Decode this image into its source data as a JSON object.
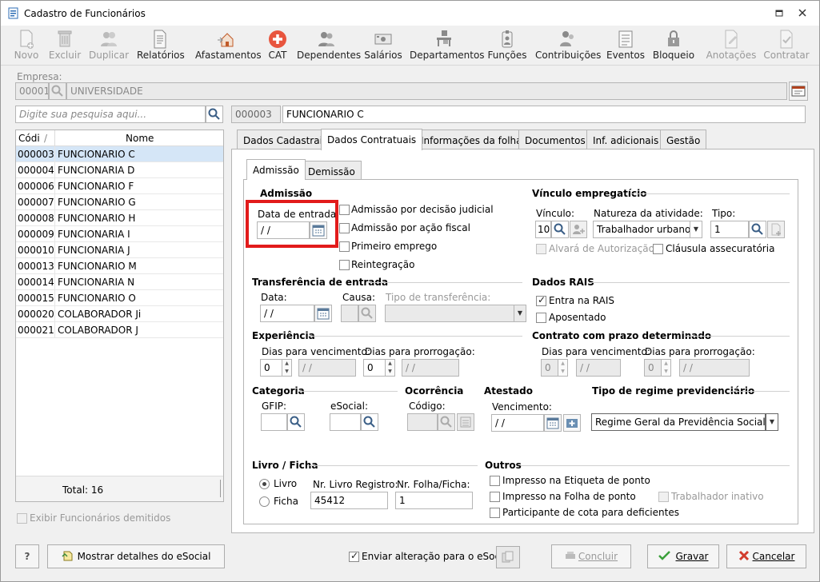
{
  "window": {
    "title": "Cadastro de Funcionários"
  },
  "toolbar": {
    "novo": "Novo",
    "excluir": "Excluir",
    "duplicar": "Duplicar",
    "relatorios": "Relatórios",
    "afastamentos": "Afastamentos",
    "cat": "CAT",
    "dependentes": "Dependentes",
    "salarios": "Salários",
    "departamentos": "Departamentos",
    "funcoes": "Funções",
    "contribuicoes": "Contribuições",
    "eventos": "Eventos",
    "bloqueio": "Bloqueio",
    "anotacoes": "Anotações",
    "contratar": "Contratar"
  },
  "empresa": {
    "label": "Empresa:",
    "code": "00001",
    "name": "UNIVERSIDADE"
  },
  "search": {
    "placeholder": "Digite sua pesquisa aqui..."
  },
  "current": {
    "code": "000003",
    "name": "FUNCIONARIO C"
  },
  "list": {
    "col_code": "Códi",
    "col_name": "Nome",
    "sort_mark": "/",
    "rows": [
      {
        "code": "000003",
        "name": "FUNCIONARIO C"
      },
      {
        "code": "000004",
        "name": "FUNCIONARIA D"
      },
      {
        "code": "000006",
        "name": "FUNCIONARIO F"
      },
      {
        "code": "000007",
        "name": "FUNCIONARIO G"
      },
      {
        "code": "000008",
        "name": "FUNCIONARIO H"
      },
      {
        "code": "000009",
        "name": "FUNCIONARIA I"
      },
      {
        "code": "000010",
        "name": "FUNCIONARIA J"
      },
      {
        "code": "000013",
        "name": "FUNCIONARIO M"
      },
      {
        "code": "000014",
        "name": "FUNCIONARIA N"
      },
      {
        "code": "000015",
        "name": "FUNCIONARIO O"
      },
      {
        "code": "000020",
        "name": "COLABORADOR Ji"
      },
      {
        "code": "000021",
        "name": "COLABORADOR J"
      }
    ],
    "total": "Total: 16"
  },
  "exibir_demitidos": "Exibir Funcionários demitidos",
  "tabs": [
    "Dados Cadastrais",
    "Dados Contratuais",
    "Informações da folha",
    "Documentos",
    "Inf. adicionais",
    "Gestão"
  ],
  "subtabs": [
    "Admissão",
    "Demissão"
  ],
  "admissao": {
    "title": "Admissão",
    "data_entrada": "Data de entrada:",
    "data_value": " / /",
    "decisao_judicial": "Admissão por decisão judicial",
    "acao_fiscal": "Admissão por ação fiscal",
    "primeiro_emprego": "Primeiro emprego",
    "reintegracao": "Reintegração"
  },
  "vinculo": {
    "title": "Vínculo empregatício",
    "vinculo_label": "Vínculo:",
    "vinculo_value": "10",
    "natureza_label": "Natureza da atividade:",
    "natureza_value": "Trabalhador urbano",
    "tipo_label": "Tipo:",
    "tipo_value": "1",
    "alvara": "Alvará de Autorização",
    "clausula": "Cláusula assecuratória"
  },
  "transferencia": {
    "title": "Transferência de entrada",
    "data_label": "Data:",
    "data_value": " / /",
    "causa_label": "Causa:",
    "tipo_label": "Tipo de transferência:"
  },
  "rais": {
    "title": "Dados RAIS",
    "entra": "Entra na RAIS",
    "aposentado": "Aposentado"
  },
  "experiencia": {
    "title": "Experiência",
    "dias_venc": "Dias para vencimento:",
    "dias_prorrog": "Dias para prorrogação:",
    "venc_value": "0",
    "venc_date": " / /",
    "prorrog_value": "0",
    "prorrog_date": " / /"
  },
  "contrato": {
    "title": "Contrato com prazo determinado",
    "dias_venc": "Dias para vencimento:",
    "dias_prorrog": "Dias para prorrogação:",
    "venc_value": "0",
    "venc_date": " / /",
    "prorrog_value": "0",
    "prorrog_date": " / /"
  },
  "categoria": {
    "title": "Categoria",
    "gfip": "GFIP:",
    "esocial": "eSocial:"
  },
  "ocorrencia": {
    "title": "Ocorrência",
    "codigo": "Código:"
  },
  "atestado": {
    "title": "Atestado",
    "vencimento": "Vencimento:",
    "venc_value": " / /"
  },
  "regime": {
    "title": "Tipo de regime previdenciário",
    "value": "Regime Geral da Previdência Social (RGP"
  },
  "livro": {
    "title": "Livro / Ficha",
    "livro": "Livro",
    "ficha": "Ficha",
    "nr_livro": "Nr. Livro Registro:",
    "nr_livro_value": "45412",
    "nr_folha": "Nr. Folha/Ficha:",
    "nr_folha_value": "1"
  },
  "outros": {
    "title": "Outros",
    "etiqueta": "Impresso na Etiqueta de ponto",
    "folha": "Impresso na Folha de ponto",
    "inativo": "Trabalhador inativo",
    "deficientes": "Participante de cota para deficientes"
  },
  "bottom": {
    "help": "?",
    "mostrar": "Mostrar detalhes do eSocial",
    "enviar": "Enviar alteração para o eSocial",
    "concluir": "Concluir",
    "gravar": "Gravar",
    "cancelar": "Cancelar"
  }
}
